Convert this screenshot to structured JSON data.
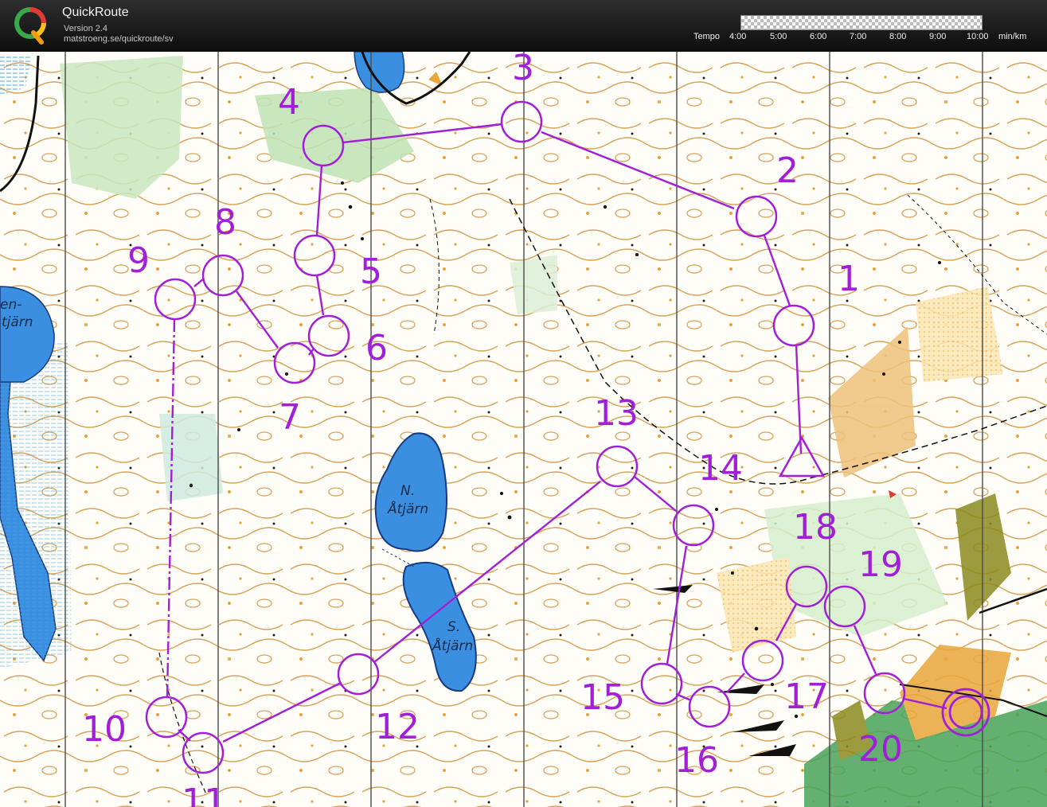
{
  "app": {
    "title": "QuickRoute",
    "version": "Version 2.4",
    "url": "matstroeng.se/quickroute/sv"
  },
  "tempo": {
    "label": "Tempo",
    "ticks": [
      "4:00",
      "5:00",
      "6:00",
      "7:00",
      "8:00",
      "9:00",
      "10:00"
    ],
    "unit": "min/km"
  },
  "map": {
    "course_color": "#a21fd8",
    "lake_labels": {
      "north_line1": "N.",
      "north_line2": "Åtjärn",
      "south_line1": "S.",
      "south_line2": "Åtjärn",
      "west_line1": "en-",
      "west_line2": "tjärn"
    },
    "control_labels": {
      "c1": "1",
      "c2": "2",
      "c3": "3",
      "c4": "4",
      "c5": "5",
      "c6": "6",
      "c7": "7",
      "c8": "8",
      "c9": "9",
      "c10": "10",
      "c11": "11",
      "c12": "12",
      "c13": "13",
      "c14": "14",
      "c15": "15",
      "c16": "16",
      "c17": "17",
      "c18": "18",
      "c19": "19",
      "c20": "20"
    }
  }
}
